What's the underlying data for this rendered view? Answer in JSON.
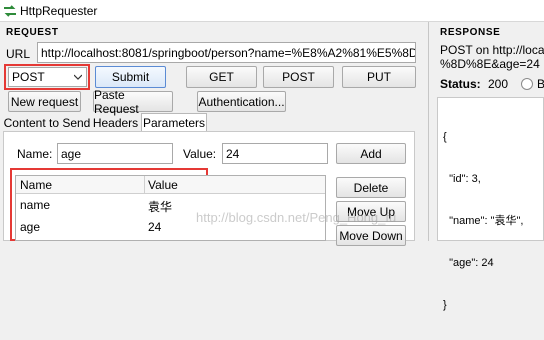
{
  "window": {
    "title": "HttpRequester"
  },
  "request": {
    "section_title": "Request",
    "url_label": "URL",
    "url_value": "http://localhost:8081/springboot/person?name=%E8%A2%81%E5%8D%",
    "method": "POST",
    "buttons": {
      "submit": "Submit",
      "get": "GET",
      "post": "POST",
      "put": "PUT"
    },
    "buttons_row2": {
      "new_request": "New request",
      "paste_request": "Paste Request",
      "authentication": "Authentication..."
    },
    "tabs": [
      "Content to Send",
      "Headers",
      "Parameters"
    ],
    "params": {
      "name_label": "Name:",
      "name_value": "age",
      "value_label": "Value:",
      "value_value": "24",
      "add": "Add",
      "columns": [
        "Name",
        "Value"
      ],
      "rows": [
        {
          "name": "name",
          "value": "袁华"
        },
        {
          "name": "age",
          "value": "24"
        }
      ],
      "delete": "Delete",
      "move_up": "Move Up",
      "move_down": "Move Down"
    }
  },
  "response": {
    "section_title": "Response",
    "line1": "POST on http://localho",
    "line2": "%8D%8E&age=24",
    "status_label": "Status:",
    "status_value": "200",
    "radio_label": "B",
    "body": [
      "{",
      "  \"id\": 3,",
      "  \"name\": \"袁华\",",
      "  \"age\": 24",
      "}"
    ]
  },
  "watermark": "http://blog.csdn.net/Peng_Hong_fu"
}
